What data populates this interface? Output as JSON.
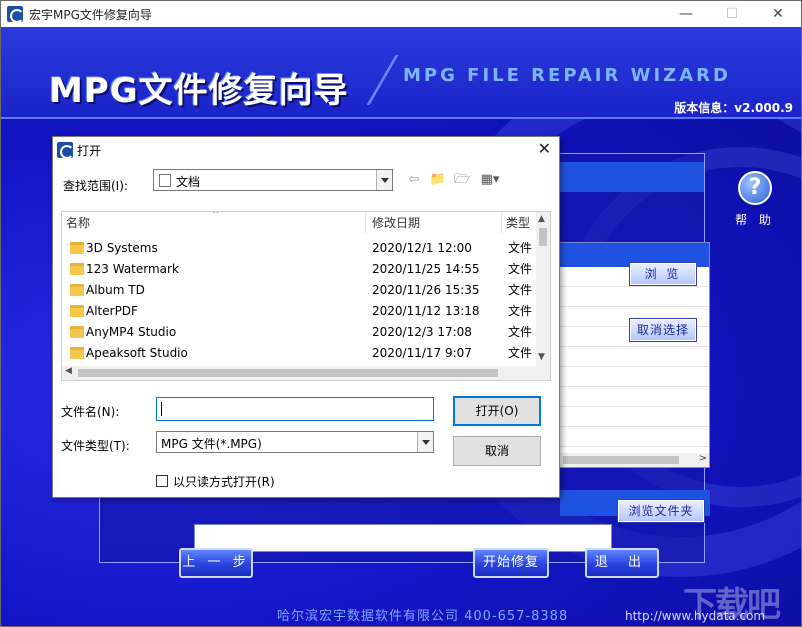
{
  "window": {
    "title": "宏宇MPG文件修复向导",
    "controls": [
      "—",
      "☐",
      "✕"
    ]
  },
  "banner": {
    "cn_title": "MPG文件修复向导",
    "en_title": "MPG FILE REPAIR WIZARD",
    "version": "版本信息：v2.000.9"
  },
  "help": {
    "symbol": "?",
    "label": "帮 助"
  },
  "panel": {
    "browse_label": "浏 览",
    "clear_label": "取消选择",
    "browse_folder_label": "浏览文件夹"
  },
  "nav": {
    "prev": "上 一 步",
    "start": "开始修复",
    "exit": "退 出"
  },
  "footer": {
    "company": "哈尔滨宏宇数据软件有限公司 400-657-8388",
    "url": "http://www.hydata.com"
  },
  "watermark": "下载吧",
  "dialog": {
    "title": "打开",
    "close": "✕",
    "lookin_label": "查找范围(I):",
    "lookin_value": "文档",
    "columns": {
      "name": "名称",
      "date": "修改日期",
      "type": "类型"
    },
    "files": [
      {
        "name": "3D Systems",
        "date": "2020/12/1 12:00",
        "type": "文件"
      },
      {
        "name": "123 Watermark",
        "date": "2020/11/25 14:55",
        "type": "文件"
      },
      {
        "name": "Album TD",
        "date": "2020/11/26 15:35",
        "type": "文件"
      },
      {
        "name": "AlterPDF",
        "date": "2020/11/12 13:18",
        "type": "文件"
      },
      {
        "name": "AnyMP4 Studio",
        "date": "2020/12/3 17:08",
        "type": "文件"
      },
      {
        "name": "Apeaksoft Studio",
        "date": "2020/11/17 9:07",
        "type": "文件"
      }
    ],
    "filename_label": "文件名(N):",
    "filename_value": "",
    "filetype_label": "文件类型(T):",
    "filetype_value": "MPG 文件(*.MPG)",
    "open_label": "打开(O)",
    "cancel_label": "取消",
    "readonly_label": "以只读方式打开(R)"
  }
}
